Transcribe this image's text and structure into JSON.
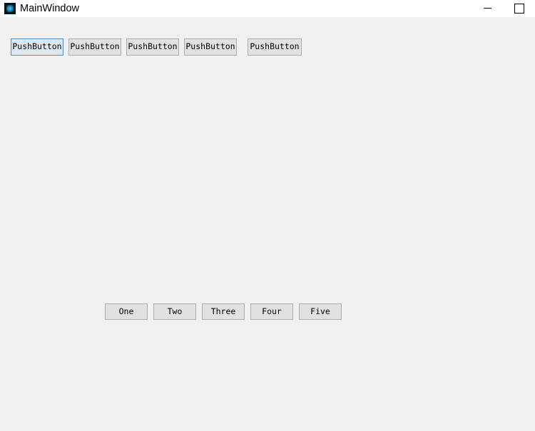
{
  "window": {
    "title": "MainWindow",
    "icon": "qt-logo-icon",
    "background_color": "#f0f0f0",
    "titlebar_color": "#ffffff"
  },
  "titlebar": {
    "controls": [
      {
        "name": "minimize",
        "glyph": "minimize-icon",
        "label": "Minimize"
      },
      {
        "name": "maximize",
        "glyph": "maximize-icon",
        "label": "Maximize"
      }
    ]
  },
  "top_row": {
    "focused_index": 0,
    "focus_border_color": "#4f90c4",
    "focus_fill_color": "#dce7f2",
    "button_fill_color": "#e1e1e1",
    "button_border_color": "#adadad",
    "buttons": [
      {
        "label": "PushButton"
      },
      {
        "label": "PushButton"
      },
      {
        "label": "PushButton"
      },
      {
        "label": "PushButton"
      },
      {
        "label": "PushButton"
      }
    ]
  },
  "bottom_row": {
    "buttons": [
      {
        "label": "One"
      },
      {
        "label": "Two"
      },
      {
        "label": "Three"
      },
      {
        "label": "Four"
      },
      {
        "label": "Five"
      }
    ]
  }
}
